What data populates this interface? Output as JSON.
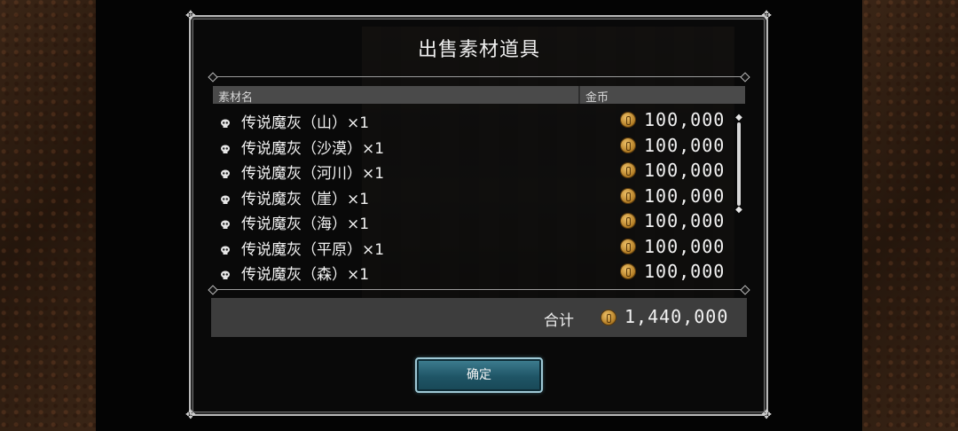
{
  "dialog": {
    "title": "出售素材道具",
    "columns": {
      "name": "素材名",
      "gold": "金币"
    },
    "items": [
      {
        "name": "传说魔灰（山）×1",
        "price": "100,000"
      },
      {
        "name": "传说魔灰（沙漠）×1",
        "price": "100,000"
      },
      {
        "name": "传说魔灰（河川）×1",
        "price": "100,000"
      },
      {
        "name": "传说魔灰（崖）×1",
        "price": "100,000"
      },
      {
        "name": "传说魔灰（海）×1",
        "price": "100,000"
      },
      {
        "name": "传说魔灰（平原）×1",
        "price": "100,000"
      },
      {
        "name": "传说魔灰（森）×1",
        "price": "100,000"
      }
    ],
    "total": {
      "label": "合计",
      "value": "1,440,000"
    },
    "confirm_label": "确定"
  },
  "icons": {
    "item": "skull-ash-icon",
    "currency": "gold-coin-icon"
  },
  "colors": {
    "accent_button": "#1f5566",
    "button_border": "#9fc9d6",
    "coin": "#d19a3a"
  }
}
